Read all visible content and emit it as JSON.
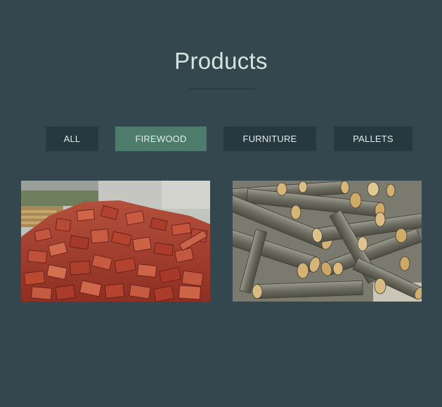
{
  "page": {
    "title": "Products",
    "background": "#34474f",
    "accent": "#4d7b6c"
  },
  "filters": [
    {
      "label": "ALL",
      "active": false
    },
    {
      "label": "FIREWOOD",
      "active": true
    },
    {
      "label": "FURNITURE",
      "active": false
    },
    {
      "label": "PALLETS",
      "active": false
    }
  ],
  "gallery": [
    {
      "subject": "chopped reddish wood blocks pile"
    },
    {
      "subject": "stacked firewood logs"
    }
  ]
}
